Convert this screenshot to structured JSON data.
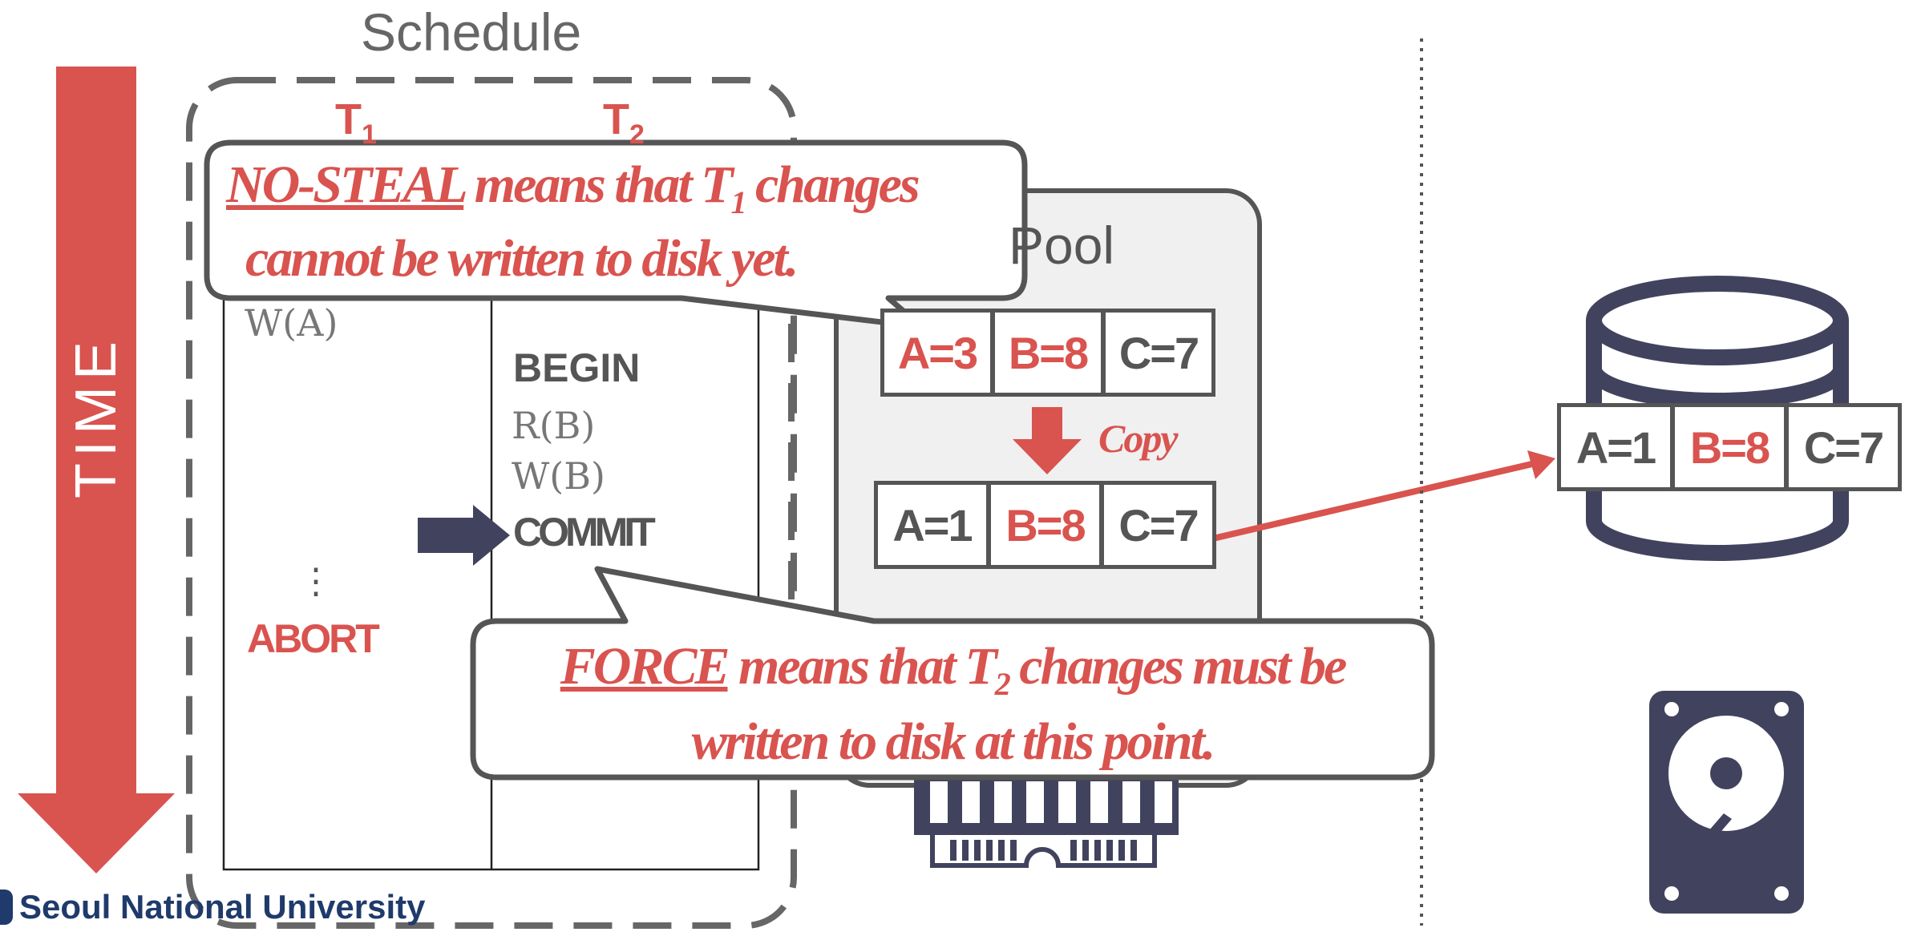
{
  "schedule_title": "Schedule",
  "time_label": "TIME",
  "t1": {
    "letter": "T",
    "sub": "1"
  },
  "t2": {
    "letter": "T",
    "sub": "2"
  },
  "t1_ops": [
    "W(A)"
  ],
  "t1_dots": "⋮",
  "t1_abort": "ABORT",
  "t2_begin": "BEGIN",
  "t2_ops": [
    "R(B)",
    "W(B)"
  ],
  "t2_commit": "COMMIT",
  "pool_label": "Pool",
  "copy_label": "Copy",
  "buffer_top": [
    "A=3",
    "B=8",
    "C=7"
  ],
  "buffer_bottom": [
    "A=1",
    "B=8",
    "C=7"
  ],
  "disk_values": [
    "A=1",
    "B=8",
    "C=7"
  ],
  "callout_nosteal": {
    "term": "NO-STEAL",
    "line1_pre": " means that T",
    "line1_sub": "1",
    "line1_post": " changes",
    "line2": "cannot be written to disk yet."
  },
  "callout_force": {
    "term": "FORCE",
    "line1_pre": " means that T",
    "line1_sub": "2",
    "line1_post": " changes must be",
    "line2": "written to disk at this point."
  },
  "footer": "Seoul National University",
  "colors": {
    "accent": "#d9534f",
    "navy": "#41435e",
    "gray": "#555555"
  }
}
